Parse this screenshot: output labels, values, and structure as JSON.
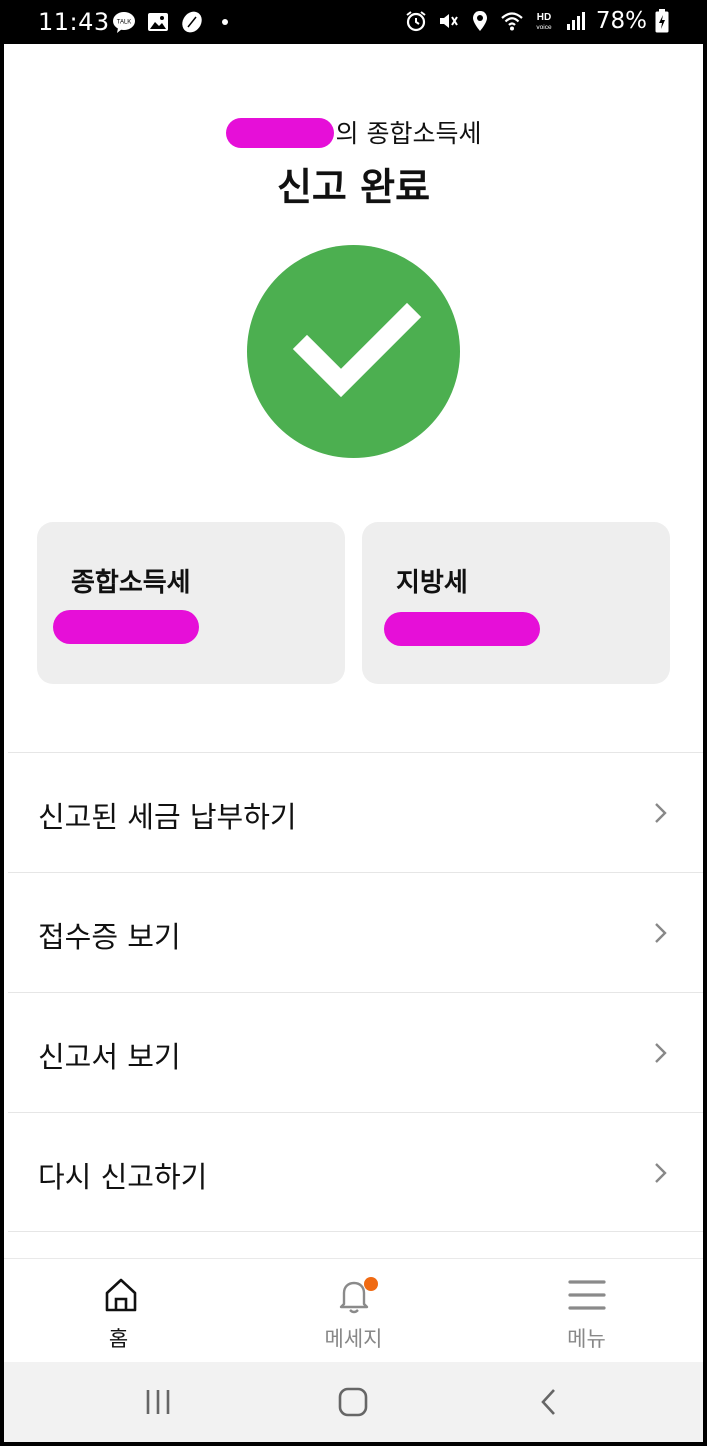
{
  "status_bar": {
    "time": "11:43",
    "left_icons": [
      "kakaotalk-icon",
      "gallery-icon",
      "bean-icon",
      "dot-icon"
    ],
    "right_icons": [
      "alarm-icon",
      "mute-icon",
      "location-icon",
      "wifi-icon",
      "hd-voice-icon",
      "signal-icon"
    ],
    "battery": "78%"
  },
  "header": {
    "subtitle_suffix": "의 종합소득세",
    "title": "신고 완료"
  },
  "status_icon": "check-circle-icon",
  "colors": {
    "success_green": "#4caf50",
    "badge_orange": "#f06a12",
    "redaction_magenta": "#e60fd8",
    "card_bg": "#eeeeee"
  },
  "cards": [
    {
      "label": "종합소득세"
    },
    {
      "label": "지방세"
    }
  ],
  "menu_items": [
    {
      "label": "신고된 세금 납부하기"
    },
    {
      "label": "접수증 보기"
    },
    {
      "label": "신고서 보기"
    },
    {
      "label": "다시 신고하기"
    }
  ],
  "bottom_nav": [
    {
      "label": "홈",
      "icon": "home-icon",
      "active": true
    },
    {
      "label": "메세지",
      "icon": "bell-icon",
      "badge": true
    },
    {
      "label": "메뉴",
      "icon": "menu-icon"
    }
  ],
  "system_nav": [
    "recents-icon",
    "home-button-icon",
    "back-icon"
  ]
}
